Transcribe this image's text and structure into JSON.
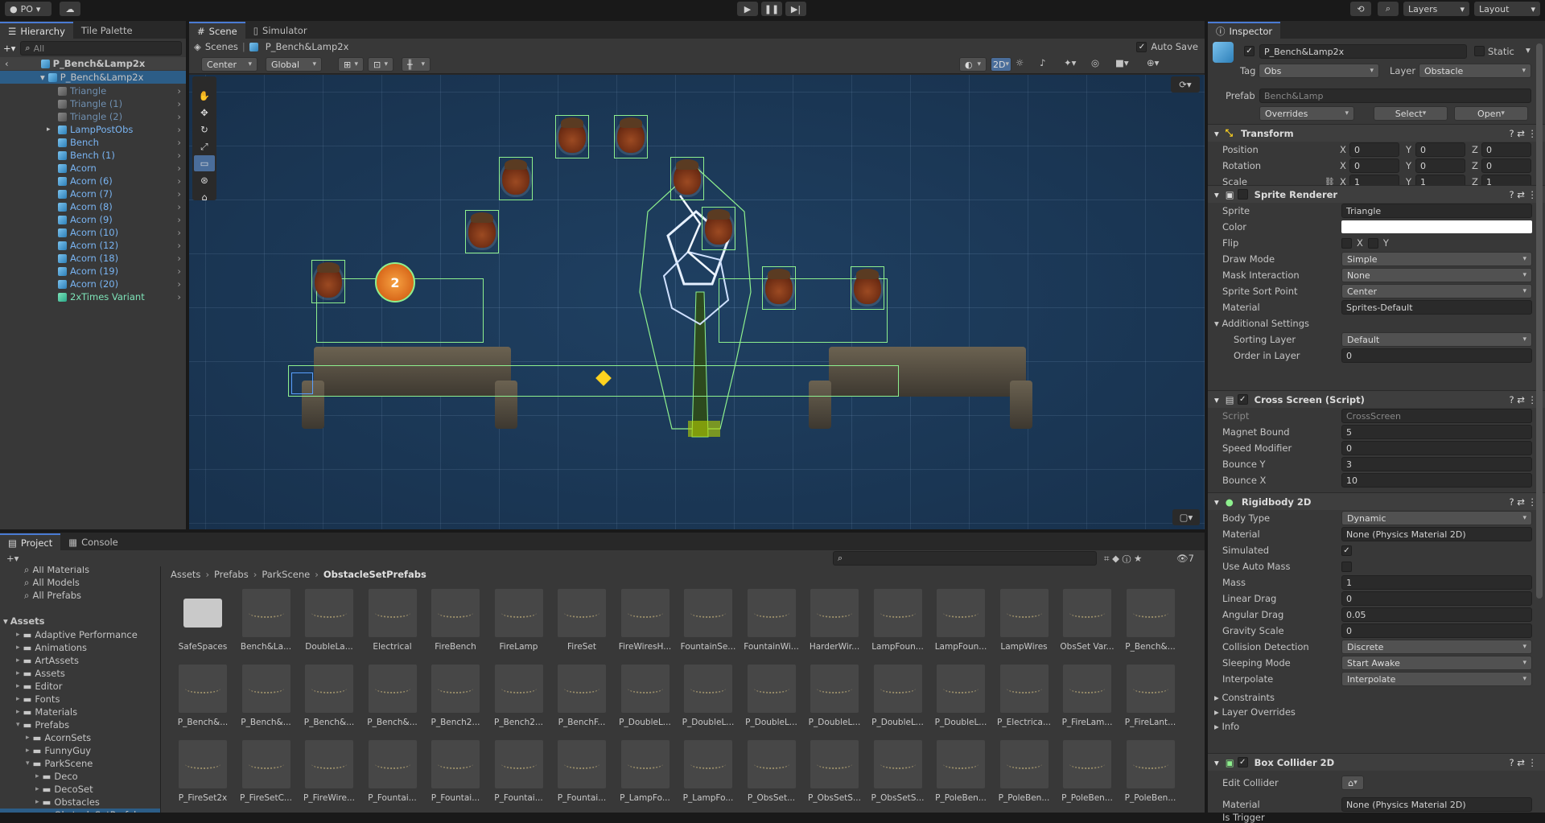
{
  "topbar": {
    "account": "PO",
    "layers": "Layers",
    "layout": "Layout"
  },
  "hierarchy": {
    "tab": "Hierarchy",
    "tab2": "Tile Palette",
    "search_placeholder": "All",
    "root": "P_Bench&Lamp2x",
    "prefab": "P_Bench&Lamp2x",
    "items": [
      {
        "label": "Triangle",
        "style": "grey",
        "indent": 1
      },
      {
        "label": "Triangle (1)",
        "style": "grey",
        "indent": 1
      },
      {
        "label": "Triangle (2)",
        "style": "grey",
        "indent": 1
      },
      {
        "label": "LampPostObs",
        "style": "blue",
        "indent": 1
      },
      {
        "label": "Bench",
        "style": "blue",
        "indent": 1
      },
      {
        "label": "Bench (1)",
        "style": "blue",
        "indent": 1
      },
      {
        "label": "Acorn",
        "style": "blue",
        "indent": 1
      },
      {
        "label": "Acorn (6)",
        "style": "blue",
        "indent": 1
      },
      {
        "label": "Acorn (7)",
        "style": "blue",
        "indent": 1
      },
      {
        "label": "Acorn (8)",
        "style": "blue",
        "indent": 1
      },
      {
        "label": "Acorn (9)",
        "style": "blue",
        "indent": 1
      },
      {
        "label": "Acorn (10)",
        "style": "blue",
        "indent": 1
      },
      {
        "label": "Acorn (12)",
        "style": "blue",
        "indent": 1
      },
      {
        "label": "Acorn (18)",
        "style": "blue",
        "indent": 1
      },
      {
        "label": "Acorn (19)",
        "style": "blue",
        "indent": 1
      },
      {
        "label": "Acorn (20)",
        "style": "blue",
        "indent": 1
      },
      {
        "label": "2xTimes Variant",
        "style": "green",
        "indent": 1
      }
    ]
  },
  "scene": {
    "tab": "Scene",
    "tab2": "Simulator",
    "breadcrumb_root": "Scenes",
    "breadcrumb_prefab": "P_Bench&Lamp2x",
    "autosave": "Auto Save",
    "pivot": "Center",
    "space": "Global",
    "mode2d": "2D"
  },
  "inspector": {
    "tab": "Inspector",
    "object_name": "P_Bench&Lamp2x",
    "static": "Static",
    "tag_label": "Tag",
    "tag": "Obs",
    "layer_label": "Layer",
    "layer": "Obstacle",
    "prefab_label": "Prefab",
    "prefab": "Bench&Lamp",
    "overrides": "Overrides",
    "select": "Select",
    "open": "Open",
    "transform": {
      "title": "Transform",
      "rows": [
        {
          "label": "Position",
          "x": "0",
          "y": "0",
          "z": "0"
        },
        {
          "label": "Rotation",
          "x": "0",
          "y": "0",
          "z": "0"
        },
        {
          "label": "Scale",
          "x": "1",
          "y": "1",
          "z": "1"
        }
      ]
    },
    "sprite_renderer": {
      "title": "Sprite Renderer",
      "sprite_label": "Sprite",
      "sprite": "Triangle",
      "color_label": "Color",
      "flip_label": "Flip",
      "flip_x": "X",
      "flip_y": "Y",
      "draw_mode_label": "Draw Mode",
      "draw_mode": "Simple",
      "mask_label": "Mask Interaction",
      "mask": "None",
      "sort_point_label": "Sprite Sort Point",
      "sort_point": "Center",
      "material_label": "Material",
      "material": "Sprites-Default",
      "additional": "Additional Settings",
      "sorting_layer_label": "Sorting Layer",
      "sorting_layer": "Default",
      "order_label": "Order in Layer",
      "order": "0"
    },
    "cross_screen": {
      "title": "Cross Screen (Script)",
      "script_label": "Script",
      "script": "CrossScreen",
      "rows": [
        {
          "label": "Magnet Bound",
          "value": "5"
        },
        {
          "label": "Speed Modifier",
          "value": "0"
        },
        {
          "label": "Bounce Y",
          "value": "3"
        },
        {
          "label": "Bounce X",
          "value": "10"
        }
      ]
    },
    "rigidbody": {
      "title": "Rigidbody 2D",
      "body_type_label": "Body Type",
      "body_type": "Dynamic",
      "material_label": "Material",
      "material": "None (Physics Material 2D)",
      "simulated_label": "Simulated",
      "auto_mass_label": "Use Auto Mass",
      "mass_label": "Mass",
      "mass": "1",
      "linear_drag_label": "Linear Drag",
      "linear_drag": "0",
      "angular_drag_label": "Angular Drag",
      "angular_drag": "0.05",
      "gravity_label": "Gravity Scale",
      "gravity": "0",
      "collision_label": "Collision Detection",
      "collision": "Discrete",
      "sleep_label": "Sleeping Mode",
      "sleep": "Start Awake",
      "interp_label": "Interpolate",
      "interp": "Interpolate",
      "constraints": "Constraints",
      "layer_overrides": "Layer Overrides",
      "info": "Info"
    },
    "box_collider": {
      "title": "Box Collider 2D",
      "edit_label": "Edit Collider",
      "material_label": "Material",
      "material": "None (Physics Material 2D)",
      "trigger_label": "Is Trigger"
    }
  },
  "project": {
    "tab": "Project",
    "tab2": "Console",
    "favorites": [
      "All Materials",
      "All Models",
      "All Prefabs"
    ],
    "assets_root": "Assets",
    "tree": [
      {
        "label": "Adaptive Performance",
        "indent": 1
      },
      {
        "label": "Animations",
        "indent": 1
      },
      {
        "label": "ArtAssets",
        "indent": 1
      },
      {
        "label": "Assets",
        "indent": 1
      },
      {
        "label": "Editor",
        "indent": 1
      },
      {
        "label": "Fonts",
        "indent": 1
      },
      {
        "label": "Materials",
        "indent": 1
      },
      {
        "label": "Prefabs",
        "indent": 1
      },
      {
        "label": "AcornSets",
        "indent": 2
      },
      {
        "label": "FunnyGuy",
        "indent": 2
      },
      {
        "label": "ParkScene",
        "indent": 2
      },
      {
        "label": "Deco",
        "indent": 3
      },
      {
        "label": "DecoSet",
        "indent": 3
      },
      {
        "label": "Obstacles",
        "indent": 3
      },
      {
        "label": "ObstacleSetPrefabs",
        "indent": 3
      }
    ],
    "breadcrumb": [
      "Assets",
      "Prefabs",
      "ParkScene",
      "ObstacleSetPrefabs"
    ],
    "count": "7",
    "grid": [
      [
        "SafeSpaces",
        "Bench&La...",
        "DoubleLa...",
        "Electrical",
        "FireBench",
        "FireLamp",
        "FireSet",
        "FireWiresH...",
        "FountainSe...",
        "FountainWi...",
        "HarderWir...",
        "LampFoun...",
        "LampFoun...",
        "LampWires",
        "ObsSet Var...",
        "P_Bench&..."
      ],
      [
        "P_Bench&...",
        "P_Bench&...",
        "P_Bench&...",
        "P_Bench&...",
        "P_Bench2...",
        "P_Bench2...",
        "P_BenchF...",
        "P_DoubleL...",
        "P_DoubleL...",
        "P_DoubleL...",
        "P_DoubleL...",
        "P_DoubleL...",
        "P_DoubleL...",
        "P_Electrica...",
        "P_FireLam...",
        "P_FireLant..."
      ],
      [
        "P_FireSet2x",
        "P_FireSetC...",
        "P_FireWire...",
        "P_Fountai...",
        "P_Fountai...",
        "P_Fountai...",
        "P_Fountai...",
        "P_LampFo...",
        "P_LampFo...",
        "P_ObsSet...",
        "P_ObsSetS...",
        "P_ObsSetS...",
        "P_PoleBen...",
        "P_PoleBen...",
        "P_PoleBen...",
        "P_PoleBen..."
      ]
    ]
  }
}
